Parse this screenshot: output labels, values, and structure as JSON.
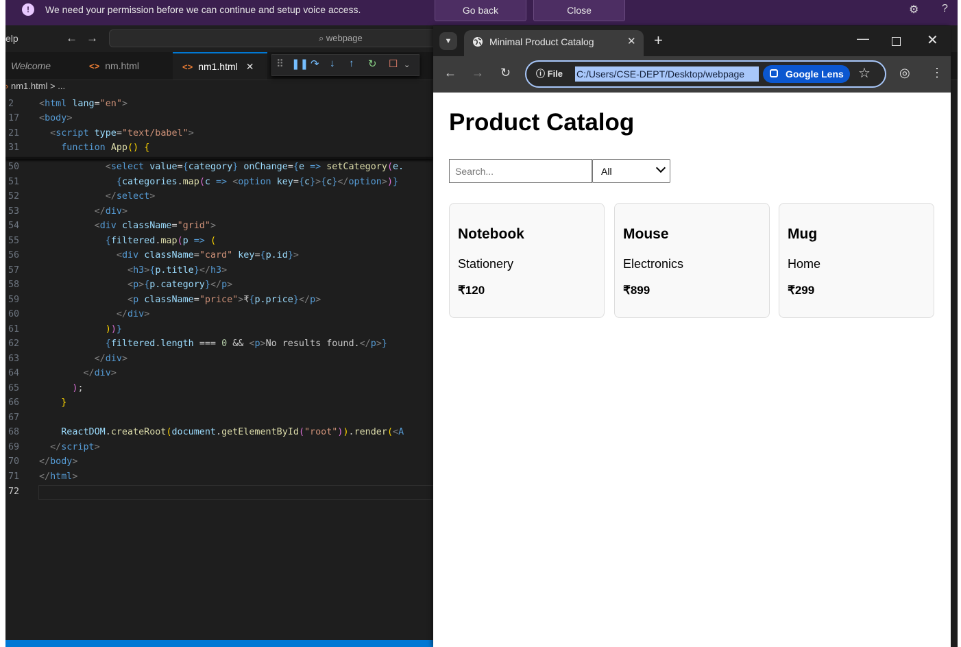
{
  "notification": {
    "message": "We need your permission before we can continue and setup voice access.",
    "go_back": "Go back",
    "close": "Close"
  },
  "vscode": {
    "menu_help": "elp",
    "command_center": "webpage",
    "tabs": [
      {
        "label": "Welcome"
      },
      {
        "label": "nm.html"
      },
      {
        "label": "nm1.html",
        "close": "✕"
      }
    ],
    "breadcrumb": "nm1.html > ...",
    "code_lines": [
      {
        "n": "2"
      },
      {
        "n": "17"
      },
      {
        "n": "21"
      },
      {
        "n": "31"
      },
      {
        "n": "50"
      },
      {
        "n": "51"
      },
      {
        "n": "52"
      },
      {
        "n": "53"
      },
      {
        "n": "54"
      },
      {
        "n": "55"
      },
      {
        "n": "56"
      },
      {
        "n": "57"
      },
      {
        "n": "58"
      },
      {
        "n": "59"
      },
      {
        "n": "60"
      },
      {
        "n": "61"
      },
      {
        "n": "62"
      },
      {
        "n": "63"
      },
      {
        "n": "64"
      },
      {
        "n": "65"
      },
      {
        "n": "66"
      },
      {
        "n": "67"
      },
      {
        "n": "68"
      },
      {
        "n": "69"
      },
      {
        "n": "70"
      },
      {
        "n": "71"
      },
      {
        "n": "72"
      }
    ]
  },
  "chrome": {
    "tab_title": "Minimal Product Catalog",
    "url_scheme": "File",
    "url": "C:/Users/CSE-DEPT/Desktop/webpage",
    "lens_label": "Google Lens"
  },
  "page": {
    "heading": "Product Catalog",
    "search_placeholder": "Search...",
    "category_selected": "All",
    "products": [
      {
        "title": "Notebook",
        "category": "Stationery",
        "price": "₹120"
      },
      {
        "title": "Mouse",
        "category": "Electronics",
        "price": "₹899"
      },
      {
        "title": "Mug",
        "category": "Home",
        "price": "₹299"
      }
    ]
  },
  "colors": {
    "vscode_bg": "#1e1e1e",
    "accent_blue": "#0078d4",
    "notification_bg": "#3b1f4f",
    "url_highlight": "#a8c7fa",
    "lens_button": "#0b57d0"
  }
}
